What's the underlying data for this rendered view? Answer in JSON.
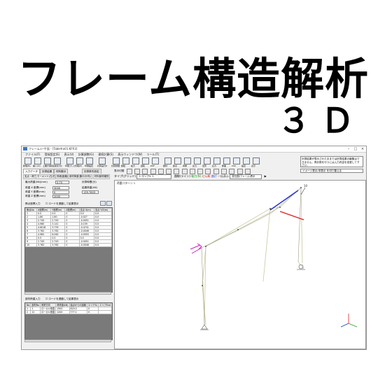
{
  "banner": {
    "title": "フレーム構造解析",
    "subtitle": "３Ｄ"
  },
  "window": {
    "title": "フレームｺﾝｰ平面 - [Tablefra01.KFR3]",
    "controls": [
      "–",
      "□",
      "×"
    ],
    "menu": [
      "ファイル(F)",
      "登録設定(E)",
      "表示(V)",
      "計算調整(G)",
      "連続計算(S)",
      "表示ウィンドウ(W)",
      "ツール(T)"
    ]
  },
  "toolbar": {
    "buttons": [
      "新規(N)",
      "開く(O)",
      "上書き保存",
      "名前を付けて保存",
      "印刷プレビュー",
      "印刷(P)",
      "印刷設定",
      "計算実行(E)",
      "計算詳細",
      "移動",
      "拡大",
      "回転",
      "DXF",
      "部材",
      "節点",
      "荷重",
      "反力",
      "変形",
      "応力",
      "断面",
      "CSV",
      "設定",
      "表示"
    ]
  },
  "info_panel": {
    "message": "計算結果が表示されたままでは計算結果の編集はできません。再計算を行うには入力内容を変更して下さい。",
    "dropdown": "イメージ表示/非表示 を切り替える"
  },
  "left": {
    "tabs": [
      "入力データ",
      "計算結果",
      "材料集計"
    ],
    "calc_tab": "計算条件設定",
    "subtabs": [
      "支点・荷力",
      "モーメント(左/右)",
      "詳細(距離)",
      "部材荷重(集中/分布)",
      "材料部材種別"
    ],
    "fields": {
      "max_load_label": "最大荷重(kN)(mm)",
      "max_load_value": "5,70",
      "support_label": "計算時間(分)",
      "dist1_label": "荷重 X 座標(mm)",
      "dist1_value": "3000",
      "dist2_label": "荷重 Y 座標(mm)",
      "dist2_value": "0",
      "dist3_label": "荷重 Z 座標(mm)",
      "dist3_value": "2000",
      "result_label": "結果荷重(kN)",
      "result_value": "139.7603"
    },
    "section1_label": "節点座標入力",
    "checkbox1_label": "ロードを連動して結果表示",
    "grid1": {
      "headers": [
        "節点No",
        "X座標(m)",
        "Y座標(m)",
        "Z座標(m)",
        "支点 X(m)",
        "支点 Y/Z(m)"
      ],
      "rows": [
        [
          "1",
          "0.0",
          "0.0",
          "0",
          "0.0",
          "0.0"
        ],
        [
          "2",
          "1.80",
          "1.80",
          "0",
          "-0.027",
          "0.0"
        ],
        [
          "3",
          "2.745",
          "2.745",
          "0",
          "-0.0051",
          "0.0"
        ],
        [
          "4",
          "4.960",
          "3.141",
          "0",
          "-0.159",
          "0.0"
        ],
        [
          "5",
          "4.6018",
          "3.735",
          "0",
          "-0.4741",
          "0.0"
        ],
        [
          "6",
          "3.762",
          "3.762",
          "0",
          "-0.0046",
          "0.0"
        ],
        [
          "7",
          "4.962",
          "6.062",
          "0",
          "-0.0055",
          "0.0"
        ],
        [
          "8",
          "0.0",
          "0.0",
          "0",
          "0.0",
          "0.0"
        ],
        [
          "9",
          "2.745",
          "2.745",
          "0",
          "-0.0051",
          "0.0"
        ],
        [
          "10",
          "3.762",
          "3.762",
          "0",
          "-0.0046",
          "0.0"
        ]
      ]
    },
    "section2_label": "部材荷重入力",
    "checkbox2_label": "ロードを連動して結果表示",
    "grid2": {
      "headers": [
        "No",
        "部材No",
        "荷重方向",
        "荷重値(kN)",
        "始点からの距離",
        "エリアSL",
        "エリアEnd"
      ],
      "rows": [
        [
          "1",
          "1",
          "ローカル鉛直",
          "1500",
          "820.0",
          "0",
          ""
        ],
        [
          "2",
          "12",
          "ローカル鉛直",
          "1200",
          "777.1",
          "0",
          ""
        ]
      ]
    }
  },
  "view": {
    "toolbar_label": "表示切替",
    "toolbar2": {
      "type_label": "タイプ(グリッド)",
      "pattern_select": "1: サンプル 1",
      "display_label": "曲線(ライン)",
      "legend": [
        "軸力(N)",
        "せん断",
        "曲げ",
        "一括表示"
      ],
      "mode_select": "変位図(フレーム)表示"
    },
    "pattern_label": "荷重パターン 1",
    "node_label": "10"
  },
  "colors": {
    "accent": "#3a78c8",
    "frame": "#c8c8a0",
    "member_blue": "#2030d0",
    "member_red": "#e02020",
    "load_magenta": "#d020c0"
  }
}
